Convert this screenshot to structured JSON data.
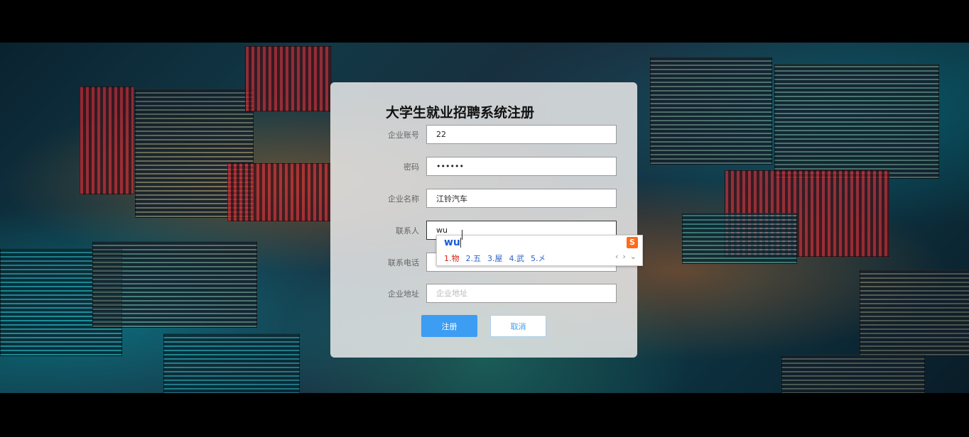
{
  "form": {
    "title": "大学生就业招聘系统注册",
    "fields": [
      {
        "label": "企业账号",
        "value": "22",
        "placeholder": ""
      },
      {
        "label": "密码",
        "value": "••••••",
        "placeholder": ""
      },
      {
        "label": "企业名称",
        "value": "江铃汽车",
        "placeholder": ""
      },
      {
        "label": "联系人",
        "value": "wu",
        "placeholder": ""
      },
      {
        "label": "联系电话",
        "value": "",
        "placeholder": ""
      },
      {
        "label": "企业地址",
        "value": "",
        "placeholder": "企业地址"
      }
    ],
    "submit_label": "注册",
    "cancel_label": "取消"
  },
  "ime": {
    "composition": "wu",
    "logo": "S",
    "candidates": [
      "1.物",
      "2.五",
      "3.屋",
      "4.武",
      "5.㐅"
    ],
    "prev": "‹",
    "next": "›",
    "expand": "⌄"
  },
  "colors": {
    "primary": "#3c9df2",
    "ime_first": "#d0201a",
    "ime_candidate": "#2b62c8"
  }
}
